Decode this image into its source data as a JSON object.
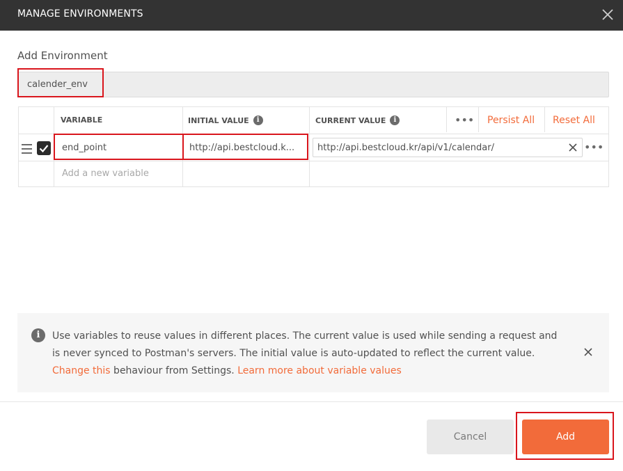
{
  "dialog": {
    "title": "MANAGE ENVIRONMENTS",
    "section_label": "Add Environment",
    "env_name_value": "calender_env"
  },
  "table": {
    "headers": {
      "variable": "VARIABLE",
      "initial_value": "INITIAL VALUE",
      "current_value": "CURRENT VALUE",
      "more": "•••",
      "persist_all": "Persist All",
      "reset_all": "Reset All"
    },
    "rows": [
      {
        "checked": true,
        "variable": "end_point",
        "initial_value": "http://api.bestcloud.k...",
        "current_value": "http://api.bestcloud.kr/api/v1/calendar/",
        "more": "•••"
      }
    ],
    "new_variable_placeholder": "Add a new variable"
  },
  "info": {
    "text_before": "Use variables to reuse values in different places. The current value is used while sending a request and is never synced to Postman's servers. The initial value is auto-updated to reflect the current value. ",
    "change_link": "Change this",
    "text_middle": " behaviour from Settings. ",
    "learn_link": "Learn more about variable values"
  },
  "footer": {
    "cancel_label": "Cancel",
    "add_label": "Add"
  },
  "colors": {
    "accent": "#f26b3a",
    "titlebar": "#333333",
    "highlight": "#d9151c"
  },
  "icons": {
    "close": "close-icon",
    "info": "info-icon",
    "checkbox": "checkmark-icon",
    "drag": "hamburger-icon",
    "clear": "clear-icon",
    "more": "more-dots-icon"
  }
}
